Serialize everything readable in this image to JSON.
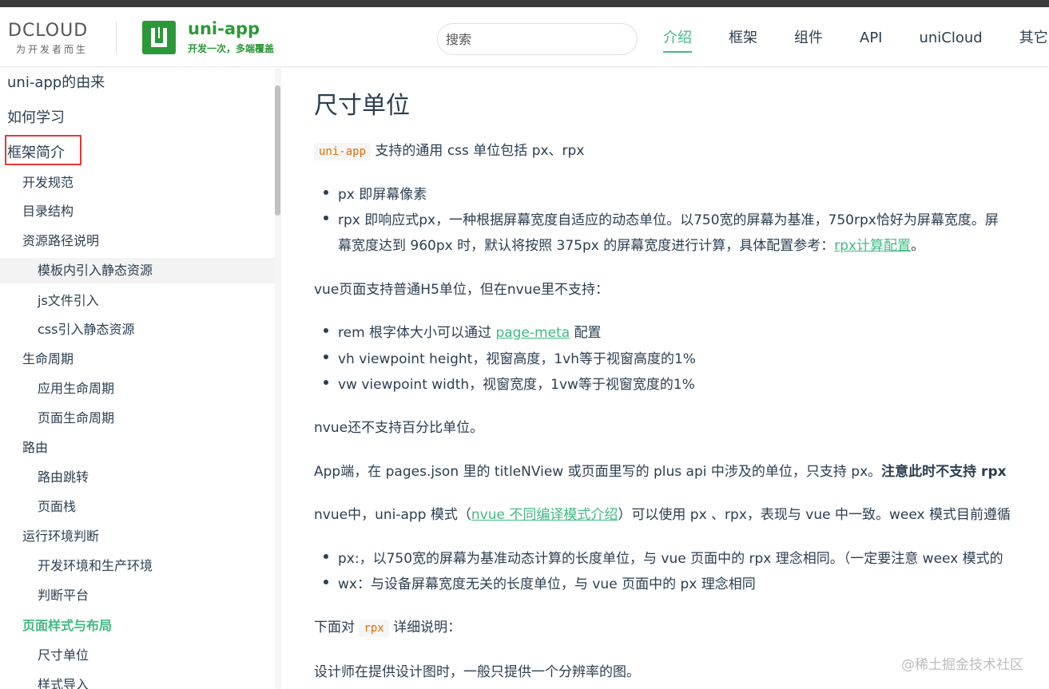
{
  "header": {
    "dcloud_logo": "DCLOUD",
    "dcloud_slogan": "为开发者而生",
    "uniapp_title": "uni-app",
    "uniapp_slogan": "开发一次，多端覆盖",
    "search_placeholder": "搜索",
    "nav": [
      "介绍",
      "框架",
      "组件",
      "API",
      "uniCloud",
      "其它"
    ],
    "nav_active": "介绍"
  },
  "sidebar": {
    "items": [
      {
        "label": "uni-app的由来",
        "level": 1
      },
      {
        "label": "如何学习",
        "level": 1
      },
      {
        "label": "框架简介",
        "level": 1
      },
      {
        "label": "开发规范",
        "level": 2
      },
      {
        "label": "目录结构",
        "level": 2
      },
      {
        "label": "资源路径说明",
        "level": 2
      },
      {
        "label": "模板内引入静态资源",
        "level": 3
      },
      {
        "label": "js文件引入",
        "level": 3
      },
      {
        "label": "css引入静态资源",
        "level": 3
      },
      {
        "label": "生命周期",
        "level": 2
      },
      {
        "label": "应用生命周期",
        "level": 3
      },
      {
        "label": "页面生命周期",
        "level": 3
      },
      {
        "label": "路由",
        "level": 2
      },
      {
        "label": "路由跳转",
        "level": 3
      },
      {
        "label": "页面栈",
        "level": 3
      },
      {
        "label": "运行环境判断",
        "level": 2
      },
      {
        "label": "开发环境和生产环境",
        "level": 3
      },
      {
        "label": "判断平台",
        "level": 3
      },
      {
        "label": "页面样式与布局",
        "level": 2
      },
      {
        "label": "尺寸单位",
        "level": 3
      },
      {
        "label": "样式导入",
        "level": 3
      }
    ]
  },
  "content": {
    "title": "尺寸单位",
    "intro_code": "uni-app",
    "intro_text": "支持的通用 css 单位包括 px、rpx",
    "list1": [
      "px 即屏幕像素",
      "rpx 即响应式px，一种根据屏幕宽度自适应的动态单位。以750宽的屏幕为基准，750rpx恰好为屏幕宽度。屏",
      "幕宽度达到 960px 时，默认将按照 375px 的屏幕宽度进行计算，具体配置参考："
    ],
    "rpx_link": "rpx计算配置",
    "rpx_link_tail": "。",
    "p_vue": "vue页面支持普通H5单位，但在nvue里不支持：",
    "rem_prefix": "rem 根字体大小可以通过",
    "rem_link": "page-meta",
    "rem_suffix": "配置",
    "vh": "vh viewpoint height，视窗高度，1vh等于视窗高度的1%",
    "vw": "vw viewpoint width，视窗宽度，1vw等于视窗宽度的1%",
    "p_nvue": "nvue还不支持百分比单位。",
    "p_app_prefix": "App端，在 pages.json 里的 titleNView 或页面里写的 plus api 中涉及的单位，只支持 px。",
    "p_app_bold": "注意此时不支持 rpx",
    "p_nvue2_prefix": "nvue中，uni-app 模式（",
    "p_nvue2_link": "nvue 不同编译模式介绍",
    "p_nvue2_suffix": "）可以使用 px 、rpx，表现与 vue 中一致。weex 模式目前遵循",
    "list3": [
      "px:，以750宽的屏幕为基准动态计算的长度单位，与 vue 页面中的 rpx 理念相同。（一定要注意 weex 模式的",
      "wx：与设备屏幕宽度无关的长度单位，与 vue 页面中的 px 理念相同"
    ],
    "p_below_prefix": "下面对",
    "p_below_code": "rpx",
    "p_below_suffix": "详细说明：",
    "p_designer": "设计师在提供设计图时，一般只提供一个分辨率的图。"
  },
  "watermark": "@稀土掘金技术社区",
  "colors": {
    "accent": "#42b983",
    "brand_green": "#2b9939",
    "highlight_box": "#e53935"
  }
}
